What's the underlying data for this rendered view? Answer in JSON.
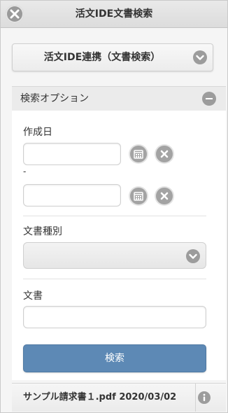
{
  "header": {
    "title": "活文IDE文書検索",
    "close_icon": "close-icon"
  },
  "main_panel": {
    "label": "活文IDE連携（文書検索）",
    "icon": "chevron-down-icon"
  },
  "options": {
    "header_label": "検索オプション",
    "collapse_icon": "minus-icon",
    "created_date": {
      "label": "作成日",
      "from_value": "",
      "range_separator": "-",
      "to_value": "",
      "calendar_icon": "calendar-icon",
      "clear_icon": "clear-icon"
    },
    "doc_type": {
      "label": "文書種別",
      "selected": "",
      "icon": "chevron-down-icon"
    },
    "document": {
      "label": "文書",
      "value": ""
    },
    "search_button": "検索"
  },
  "result": {
    "label": "サンプル請求書１.pdf 2020/03/02",
    "icon": "info-icon"
  },
  "colors": {
    "accent": "#5d89b5",
    "icon_gray": "#9c9c9c",
    "header_bg": "#e2e2e2"
  }
}
